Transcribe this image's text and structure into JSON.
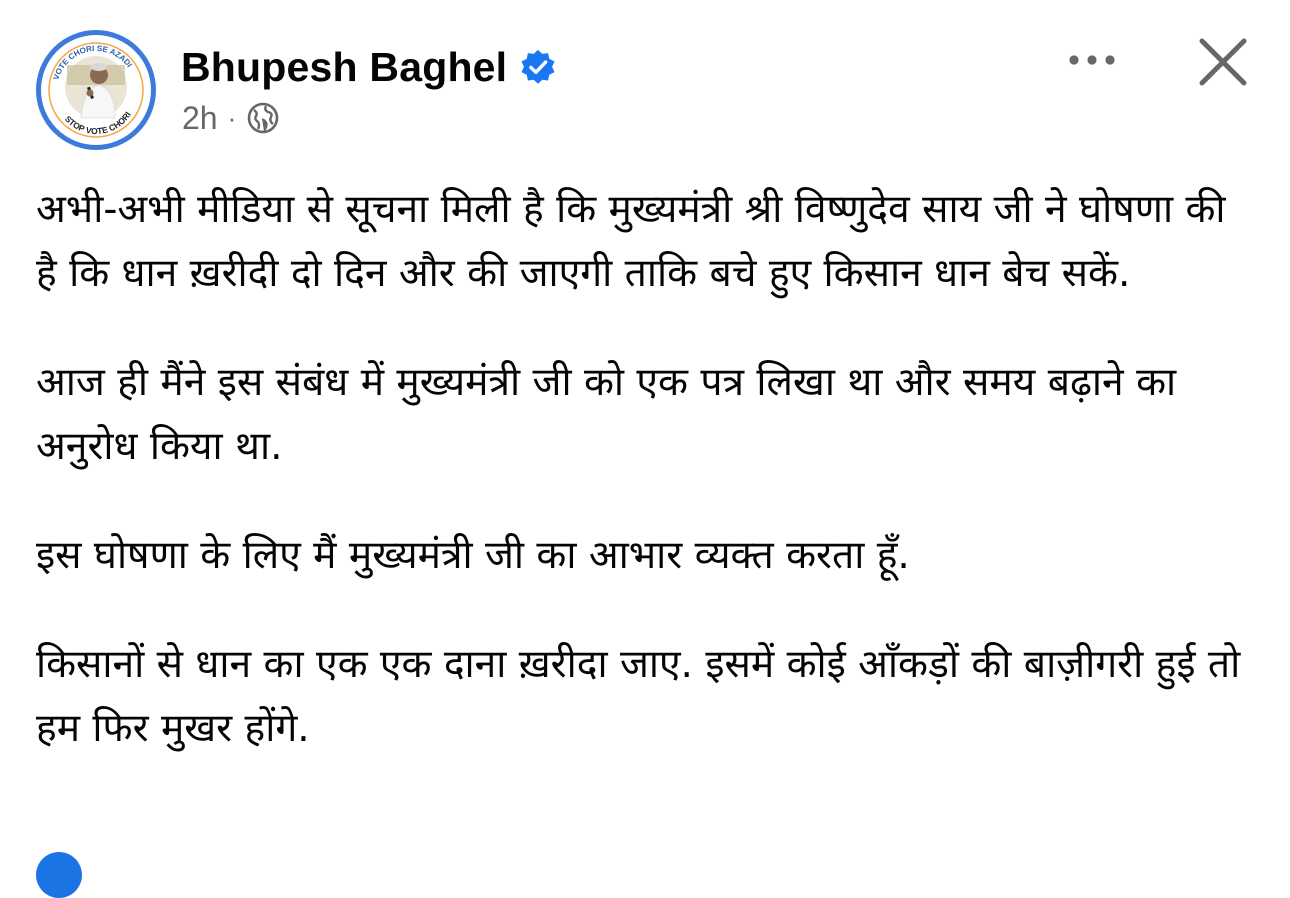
{
  "post": {
    "author": "Bhupesh Baghel",
    "verified": true,
    "timestamp": "2h",
    "separator": "·",
    "privacy_icon": "globe-icon",
    "avatar_badge_text": "STOP VOTE CHORI",
    "avatar_badge_top": "VOTE CHORI SE AZADI",
    "paragraphs": [
      "अभी-अभी मीडिया से सूचना मिली है कि मुख्यमंत्री श्री विष्णुदेव साय जी ने घोषणा की है कि धान ख़रीदी दो दिन और की जाएगी ताकि बचे हुए किसान धान बेच सकें.",
      "आज ही मैंने इस संबंध में मुख्यमंत्री जी को एक पत्र लिखा था और समय बढ़ाने का अनुरोध किया था.",
      "इस घोषणा के लिए मैं मुख्यमंत्री जी का आभार व्यक्त करता हूँ.",
      "किसानों से धान का एक एक दाना ख़रीदा जाए. इसमें कोई आँकड़ों की बाज़ीगरी हुई तो हम फिर मुखर होंगे."
    ]
  },
  "icons": {
    "more": "more-horizontal-icon",
    "close": "close-icon",
    "verified": "verified-badge-icon"
  },
  "colors": {
    "verified_blue": "#1877f2",
    "meta_gray": "#65676b",
    "text": "#050505",
    "avatar_ring": "#3b7bdc"
  }
}
